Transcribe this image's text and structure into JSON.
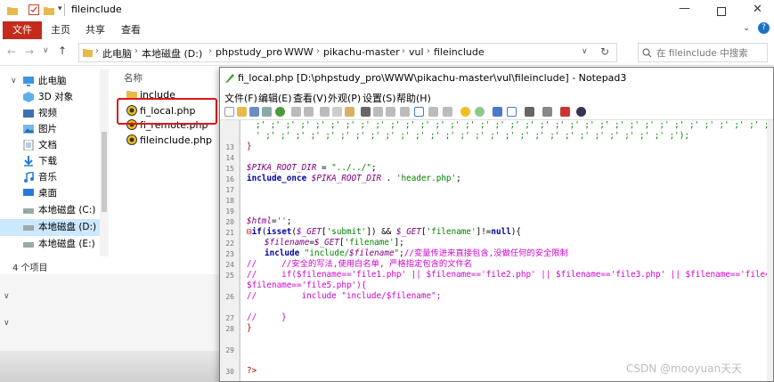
{
  "explorer": {
    "title": "fileinclude",
    "ribbon": {
      "file": "文件",
      "home": "主页",
      "share": "共享",
      "view": "查看"
    },
    "breadcrumb": [
      "此电脑",
      "本地磁盘 (D:)",
      "phpstudy_pro",
      "WWW",
      "pikachu-master",
      "vul",
      "fileinclude"
    ],
    "search_placeholder": "在 fileinclude 中搜索",
    "column_name": "名称",
    "nav": [
      {
        "label": "此电脑",
        "icon": "computer-icon"
      },
      {
        "label": "3D 对象",
        "icon": "cube-icon"
      },
      {
        "label": "视频",
        "icon": "video-icon"
      },
      {
        "label": "图片",
        "icon": "picture-icon"
      },
      {
        "label": "文档",
        "icon": "document-icon"
      },
      {
        "label": "下载",
        "icon": "download-icon"
      },
      {
        "label": "音乐",
        "icon": "music-icon"
      },
      {
        "label": "桌面",
        "icon": "desktop-icon"
      },
      {
        "label": "本地磁盘 (C:)",
        "icon": "drive-icon"
      },
      {
        "label": "本地磁盘 (D:)",
        "icon": "drive-icon",
        "selected": true
      },
      {
        "label": "本地磁盘 (E:)",
        "icon": "drive-icon"
      }
    ],
    "files": [
      {
        "name": "include",
        "icon": "folder-icon"
      },
      {
        "name": "fi_local.php",
        "icon": "php-file-icon",
        "highlighted": true
      },
      {
        "name": "fi_remote.php",
        "icon": "php-file-icon"
      },
      {
        "name": "fileinclude.php",
        "icon": "php-file-icon"
      }
    ],
    "status": "4 个项目"
  },
  "notepad": {
    "title": "fi_local.php [D:\\phpstudy_pro\\WWW\\pikachu-master\\vul\\fileinclude] - Notepad3",
    "menu": [
      "文件(F)",
      "编辑(E)",
      "查看(V)",
      "外观(P)",
      "设置(S)",
      "帮助(H)"
    ],
    "line_numbers": [
      "13",
      "14",
      "15",
      "16",
      "17",
      "18",
      "19",
      "20",
      "21",
      "22",
      "23",
      "24",
      "25",
      "26",
      "27",
      "28",
      "29",
      "30"
    ],
    "code_top": ";' ;' ;' ;' ;' ;' ;' ;' ;' ;' ;' ;' ;' ;' ;' ;' ;' ;' ;' ;' ;' ;' ;' ;' ;' ;' ;' ;' ;' ;' ;' ;' ;' ;' ;' ;' ;' ;' ;' ;'",
    "code_top2": "' ;' ;' ;' ;' ;' ;' ;' ;' ;' ;' ;' ;' ;' ;' ;' ;' ;' ;' ;' ;' ;' ;' ;' ;' ;' ;' ;' ;');"
  },
  "watermark": "CSDN @mooyuan天天"
}
